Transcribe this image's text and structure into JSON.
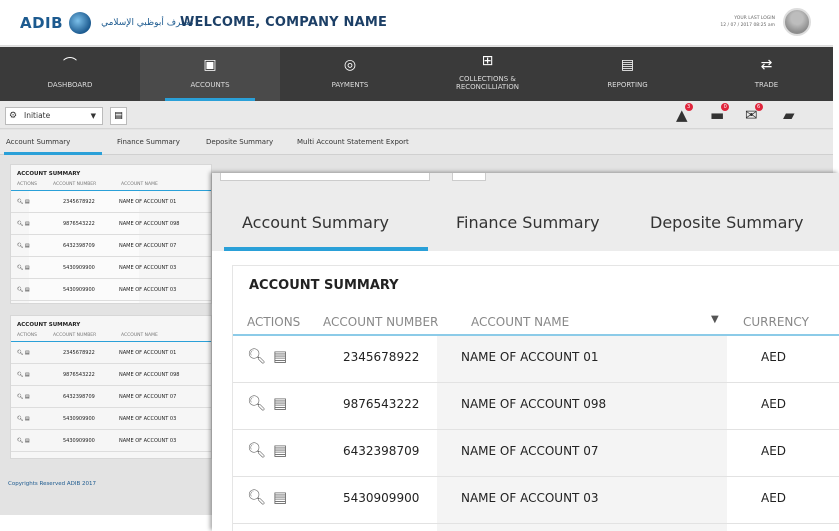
{
  "header": {
    "logo_text": "ADIB",
    "logo_arabic": "مصرف أبوظبي الإسلامي",
    "welcome": "WELCOME, COMPANY NAME",
    "last_login_label": "YOUR LAST LOGIN",
    "last_login_value": "12 / 07 / 2017 08:25 am"
  },
  "nav": [
    {
      "label": "DASHBOARD",
      "icon": "gauge-icon"
    },
    {
      "label": "ACCOUNTS",
      "icon": "accounts-icon",
      "active": true
    },
    {
      "label": "PAYMENTS",
      "icon": "payments-icon"
    },
    {
      "label": "COLLECTIONS &",
      "label2": "RECONCILLIATION",
      "icon": "collections-icon"
    },
    {
      "label": "REPORTING",
      "icon": "reporting-icon"
    },
    {
      "label": "TRADE",
      "icon": "trade-icon"
    }
  ],
  "toolbar": {
    "role_value": "Initiate",
    "badges": [
      "3",
      "0",
      "6"
    ]
  },
  "tabs": [
    "Account Summary",
    "Finance Summary",
    "Deposite Summary",
    "Multi Account Statement Export"
  ],
  "panels": [
    {
      "title": "ACCOUNT SUMMARY",
      "columns": [
        "ACTIONS",
        "ACCOUNT NUMBER",
        "ACCOUNT NAME"
      ],
      "rows": [
        {
          "number": "2345678922",
          "name": "NAME OF ACCOUNT 01"
        },
        {
          "number": "9876543222",
          "name": "NAME OF ACCOUNT 098"
        },
        {
          "number": "6432398709",
          "name": "NAME OF ACCOUNT 07"
        },
        {
          "number": "5430909900",
          "name": "NAME OF ACCOUNT 03"
        },
        {
          "number": "5430909900",
          "name": "NAME OF ACCOUNT 03"
        }
      ]
    },
    {
      "title": "ACCOUNT SUMMARY",
      "columns": [
        "ACTIONS",
        "ACCOUNT NUMBER",
        "ACCOUNT NAME"
      ],
      "rows": [
        {
          "number": "2345678922",
          "name": "NAME OF ACCOUNT 01"
        },
        {
          "number": "9876543222",
          "name": "NAME OF ACCOUNT 098"
        },
        {
          "number": "6432398709",
          "name": "NAME OF ACCOUNT 07"
        },
        {
          "number": "5430909900",
          "name": "NAME OF ACCOUNT 03"
        },
        {
          "number": "5430909900",
          "name": "NAME OF ACCOUNT 03"
        }
      ]
    }
  ],
  "footer": {
    "copyright": "Copyrights Reserved ADIB 2017"
  },
  "zoom": {
    "tabs": [
      "Account Summary",
      "Finance Summary",
      "Deposite Summary"
    ],
    "title": "ACCOUNT SUMMARY",
    "columns": [
      "ACTIONS",
      "ACCOUNT NUMBER",
      "ACCOUNT NAME",
      "CURRENCY"
    ],
    "rows": [
      {
        "number": "2345678922",
        "name": "NAME OF ACCOUNT 01",
        "currency": "AED"
      },
      {
        "number": "9876543222",
        "name": "NAME OF ACCOUNT 098",
        "currency": "AED"
      },
      {
        "number": "6432398709",
        "name": "NAME OF ACCOUNT 07",
        "currency": "AED"
      },
      {
        "number": "5430909900",
        "name": "NAME OF ACCOUNT 03",
        "currency": "AED"
      }
    ]
  },
  "colors": {
    "brand": "#1c5a8f",
    "accent": "#2aa0d8",
    "nav": "#3a3a3a",
    "badge": "#e0243b"
  }
}
